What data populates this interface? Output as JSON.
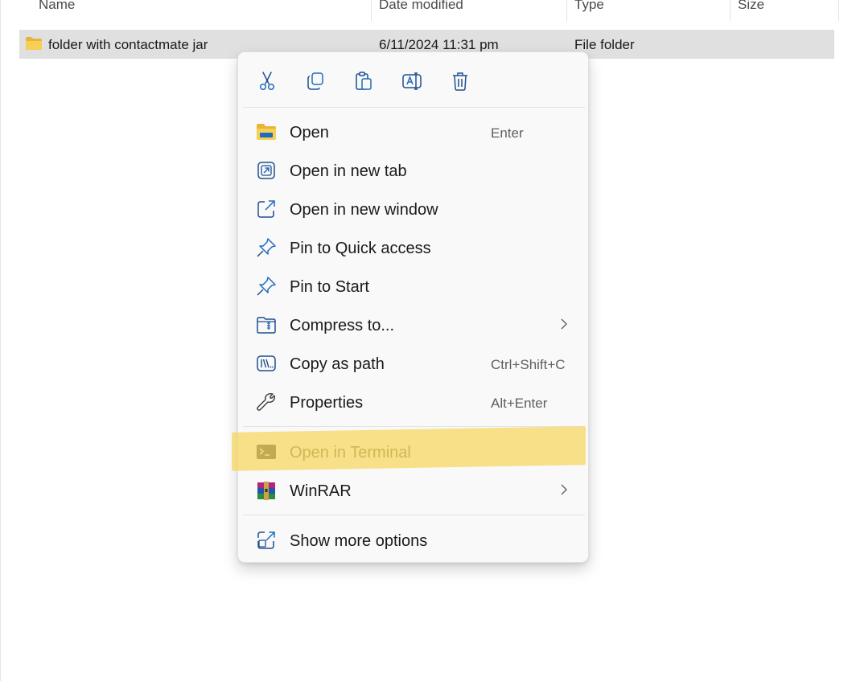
{
  "columns": {
    "name": "Name",
    "date_modified": "Date modified",
    "type": "Type",
    "size": "Size"
  },
  "selected_row": {
    "name": "folder with contactmate jar",
    "date_modified": "6/11/2024 11:31 pm",
    "type": "File folder",
    "icon": "folder-icon"
  },
  "context_menu": {
    "quick_actions": [
      {
        "name": "cut",
        "icon": "scissors-icon"
      },
      {
        "name": "copy",
        "icon": "copy-icon"
      },
      {
        "name": "paste",
        "icon": "paste-icon"
      },
      {
        "name": "rename",
        "icon": "rename-icon"
      },
      {
        "name": "delete",
        "icon": "trash-icon"
      }
    ],
    "items": [
      {
        "label": "Open",
        "shortcut": "Enter",
        "icon": "folder-open-icon"
      },
      {
        "label": "Open in new tab",
        "shortcut": "",
        "icon": "new-tab-icon"
      },
      {
        "label": "Open in new window",
        "shortcut": "",
        "icon": "new-window-icon"
      },
      {
        "label": "Pin to Quick access",
        "shortcut": "",
        "icon": "pin-icon"
      },
      {
        "label": "Pin to Start",
        "shortcut": "",
        "icon": "pin-icon"
      },
      {
        "label": "Compress to...",
        "shortcut": "",
        "icon": "zip-folder-icon",
        "submenu": true
      },
      {
        "label": "Copy as path",
        "shortcut": "Ctrl+Shift+C",
        "icon": "copy-path-icon"
      },
      {
        "label": "Properties",
        "shortcut": "Alt+Enter",
        "icon": "wrench-icon"
      },
      {
        "label": "Open in Terminal",
        "shortcut": "",
        "icon": "terminal-icon",
        "highlighted": true
      },
      {
        "label": "WinRAR",
        "shortcut": "",
        "icon": "winrar-icon",
        "submenu": true
      },
      {
        "label": "Show more options",
        "shortcut": "",
        "icon": "more-options-icon"
      }
    ]
  },
  "colors": {
    "accent": "#0f6cbd",
    "folder_yellow": "#f4c545",
    "highlight": "#f5d65c",
    "selection": "#e0e0e0"
  }
}
